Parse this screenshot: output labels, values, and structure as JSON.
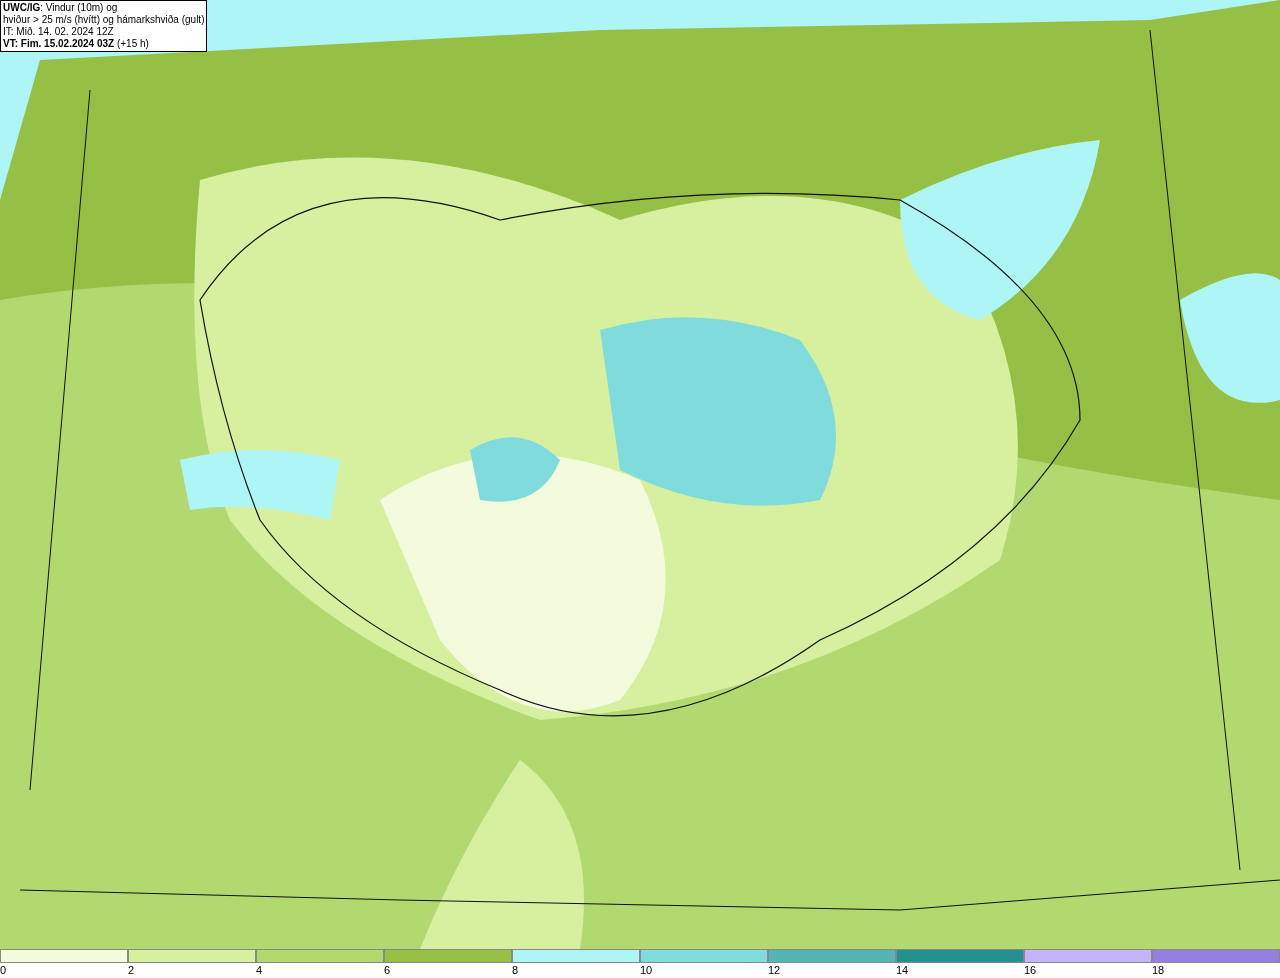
{
  "title_box": {
    "lines": [
      "**UWC/IG**: Vindur (10m) og",
      "hviður > 25 m/s (hvítt) og hámarkshviða (gult)",
      "IT: Mið. 14. 02. 2024 12Z",
      "**VT: Fim. 15.02.2024 03Z** (+15 h)"
    ]
  },
  "legend": {
    "bins": [
      {
        "label": "0",
        "color": "#f3fbdc"
      },
      {
        "label": "2",
        "color": "#d6f0a0"
      },
      {
        "label": "4",
        "color": "#b2d870"
      },
      {
        "label": "6",
        "color": "#95c045"
      },
      {
        "label": "8",
        "color": "#aef6f6"
      },
      {
        "label": "10",
        "color": "#80dcdc"
      },
      {
        "label": "12",
        "color": "#55b4b4"
      },
      {
        "label": "14",
        "color": "#259090"
      },
      {
        "label": "16",
        "color": "#c4b4fa"
      },
      {
        "label": "18",
        "color": "#9580e0"
      }
    ]
  }
}
